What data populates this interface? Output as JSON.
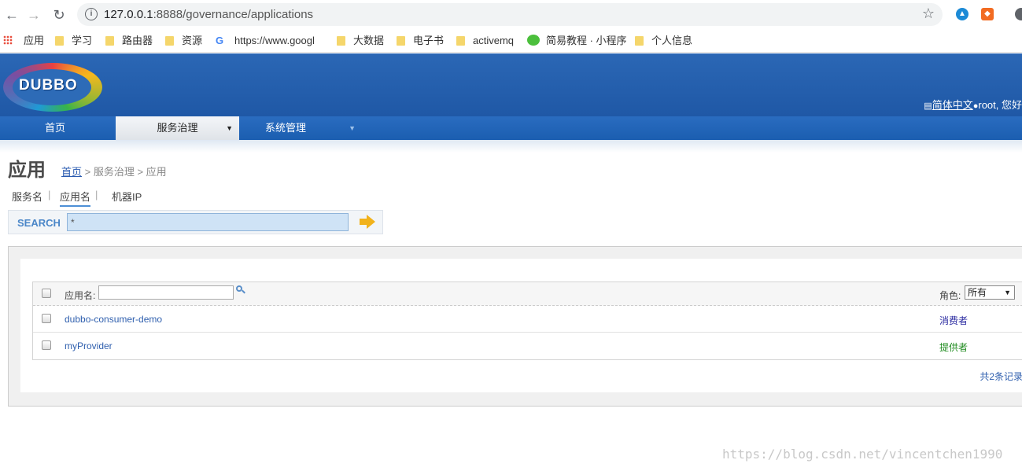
{
  "browser": {
    "url_host": "127.0.0.1",
    "url_path": ":8888/governance/applications",
    "bookmarks": [
      "应用",
      "学习",
      "路由器",
      "资源",
      "https://www.googl",
      "大数据",
      "电子书",
      "activemq",
      "简易教程 · 小程序",
      "个人信息"
    ]
  },
  "header": {
    "logo_text": "DUBBO",
    "lang_link": "简体中文",
    "user_greeting": "root, 您好"
  },
  "menu": {
    "items": [
      "首页",
      "服务治理",
      "系统管理"
    ],
    "active_arrow": "▼",
    "dropdown_arrow": "▼"
  },
  "page": {
    "title": "应用",
    "breadcrumb_home": "首页",
    "breadcrumb_rest": " > 服务治理 > 应用"
  },
  "subtabs": {
    "items": [
      "服务名",
      "应用名",
      "机器IP"
    ],
    "separator": "|"
  },
  "search": {
    "label": "SEARCH",
    "value": "*"
  },
  "table": {
    "name_header": "应用名:",
    "role_header": "角色:",
    "role_selected": "所有",
    "rows": [
      {
        "name": "dubbo-consumer-demo",
        "role": "消费者"
      },
      {
        "name": "myProvider",
        "role": "提供者"
      }
    ],
    "total": "共2条记录"
  },
  "colors": {
    "header_blue": "#1f58a6",
    "link_blue": "#2f5fae",
    "consumer": "#2a2aa0",
    "provider": "#1e8a1e"
  },
  "watermark": "https://blog.csdn.net/vincentchen1990"
}
